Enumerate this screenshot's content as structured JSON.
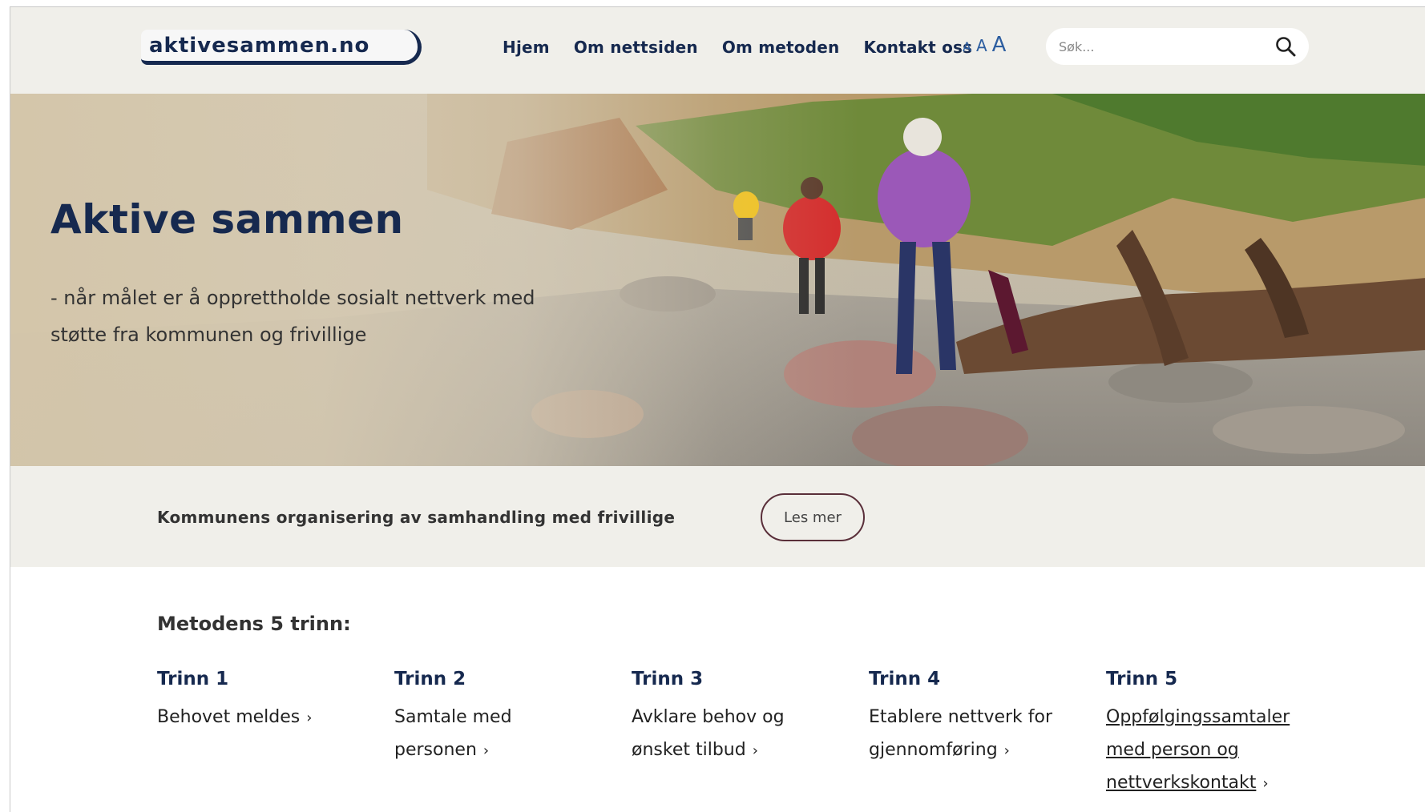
{
  "logo": {
    "text": "aktivesammen.no"
  },
  "nav": {
    "items": [
      {
        "label": "Hjem"
      },
      {
        "label": "Om nettsiden"
      },
      {
        "label": "Om metoden"
      },
      {
        "label": "Kontakt oss"
      }
    ]
  },
  "font_size_controls": {
    "small": "A",
    "medium": "A",
    "large": "A"
  },
  "search": {
    "placeholder": "Søk...",
    "icon": "search-icon"
  },
  "hero": {
    "title": "Aktive sammen",
    "subtitle": "- når målet er å opprettholde sosialt nettverk med støtte fra kommunen og frivillige"
  },
  "band": {
    "text": "Kommunens organisering av samhandling med frivillige",
    "button_label": "Les mer"
  },
  "steps": {
    "title": "Metodens 5 trinn:",
    "items": [
      {
        "label": "Trinn 1",
        "link": "Behovet meldes"
      },
      {
        "label": "Trinn 2",
        "link": "Samtale med personen"
      },
      {
        "label": "Trinn 3",
        "link": "Avklare behov og ønsket tilbud"
      },
      {
        "label": "Trinn 4",
        "link": "Etablere nettverk for gjennomføring"
      },
      {
        "label": "Trinn 5",
        "link": "Oppfølgingssamtaler med person og nettverkskontakt"
      }
    ],
    "chevron": "›"
  },
  "colors": {
    "header_bg": "#f0efea",
    "brand_navy": "#16294f",
    "accent_blue": "#2d5ea0",
    "button_border": "#5a2f3a"
  }
}
